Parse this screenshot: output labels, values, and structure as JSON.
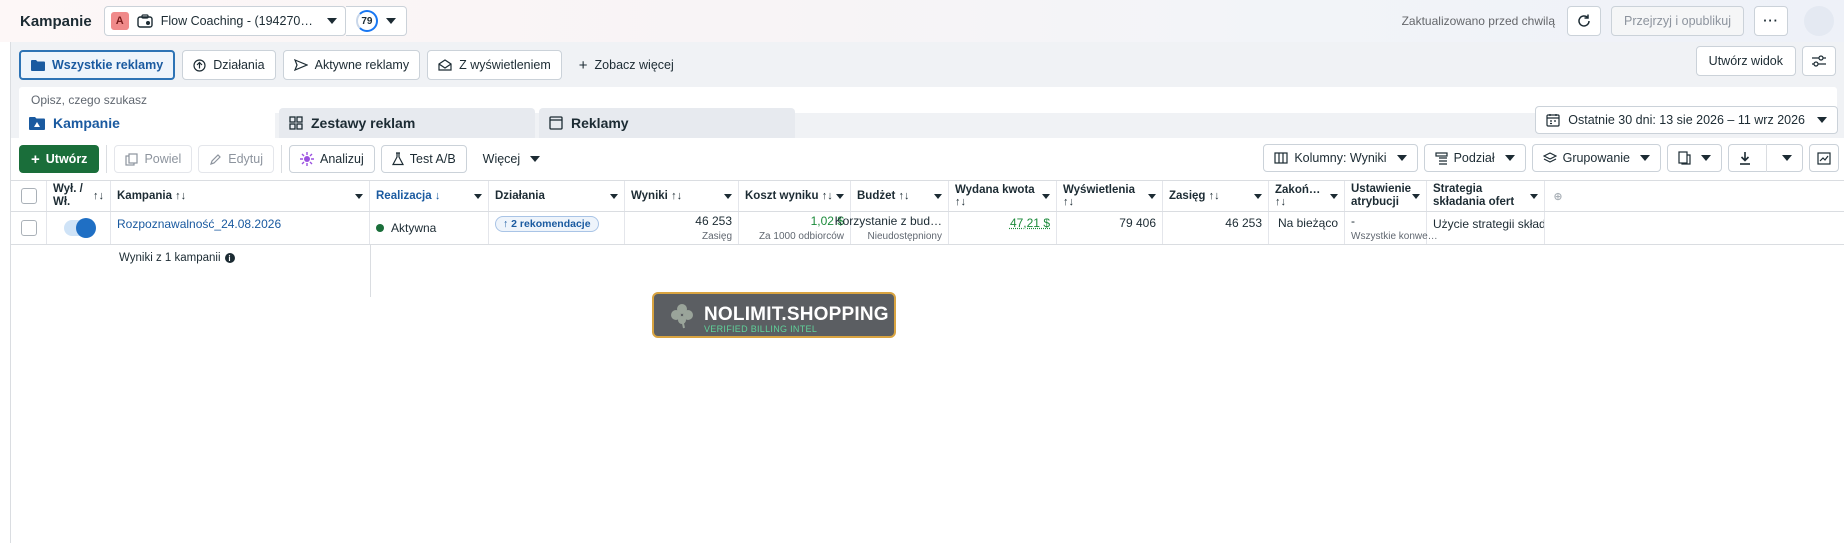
{
  "header": {
    "title": "Kampanie",
    "account_badge": "A",
    "account_name": "Flow Coaching - (194270…",
    "score": "79",
    "updated_text": "Zaktualizowano przed chwilą",
    "review_publish": "Przejrzyj i opublikuj"
  },
  "filters": {
    "chips": [
      "Wszystkie reklamy",
      "Działania",
      "Aktywne reklamy",
      "Z wyświetleniem"
    ],
    "see_more": "Zobacz więcej",
    "create_view": "Utwórz widok"
  },
  "search": {
    "placeholder": "Opisz, czego szukasz"
  },
  "tabs": [
    "Kampanie",
    "Zestawy reklam",
    "Reklamy"
  ],
  "date_range": "Ostatnie 30 dni: 13 sie 2026 – 11 wrz 2026",
  "toolbar": {
    "create": "Utwórz",
    "duplicate": "Powiel",
    "edit": "Edytuj",
    "analyze": "Analizuj",
    "ab_test": "Test A/B",
    "more": "Więcej",
    "columns": "Kolumny: Wyniki",
    "breakdown": "Podział",
    "grouping": "Grupowanie"
  },
  "table": {
    "headers": {
      "onoff": "Wył. / Wł.",
      "campaign": "Kampania",
      "delivery": "Realizacja",
      "actions": "Działania",
      "results": "Wyniki",
      "cost": "Koszt wyniku",
      "budget": "Budżet",
      "spent": "Wydana kwota",
      "impressions": "Wyświetlenia",
      "reach": "Zasięg",
      "ends": "Zakoń…",
      "attribution": "Ustawienie atrybucji",
      "bid": "Strategia składania ofert"
    },
    "row": {
      "campaign": "Rozpoznawalność_24.08.2026",
      "delivery": "Aktywna",
      "actions": "2 rekomendacje",
      "results": "46 253",
      "results_sub": "Zasięg",
      "cost": "1,02 $",
      "cost_sub": "Za 1000 odbiorców",
      "budget": "Korzystanie z bud…",
      "budget_sub": "Nieudostępniony",
      "spent": "47,21 $",
      "impressions": "79 406",
      "reach": "46 253",
      "ends": "Na bieżąco",
      "attribution": "-",
      "attribution_sub": "Wszystkie konwe…",
      "bid": "Użycie strategii składa…"
    },
    "summary": "Wyniki z 1 kampanii"
  },
  "watermark": {
    "title": "NOLIMIT.SHOPPING",
    "subtitle": "VERIFIED BILLING INTEL"
  },
  "colors": {
    "accent": "#1a5aa0",
    "create_green": "#1a6e3a",
    "positive": "#1a8a3a"
  }
}
